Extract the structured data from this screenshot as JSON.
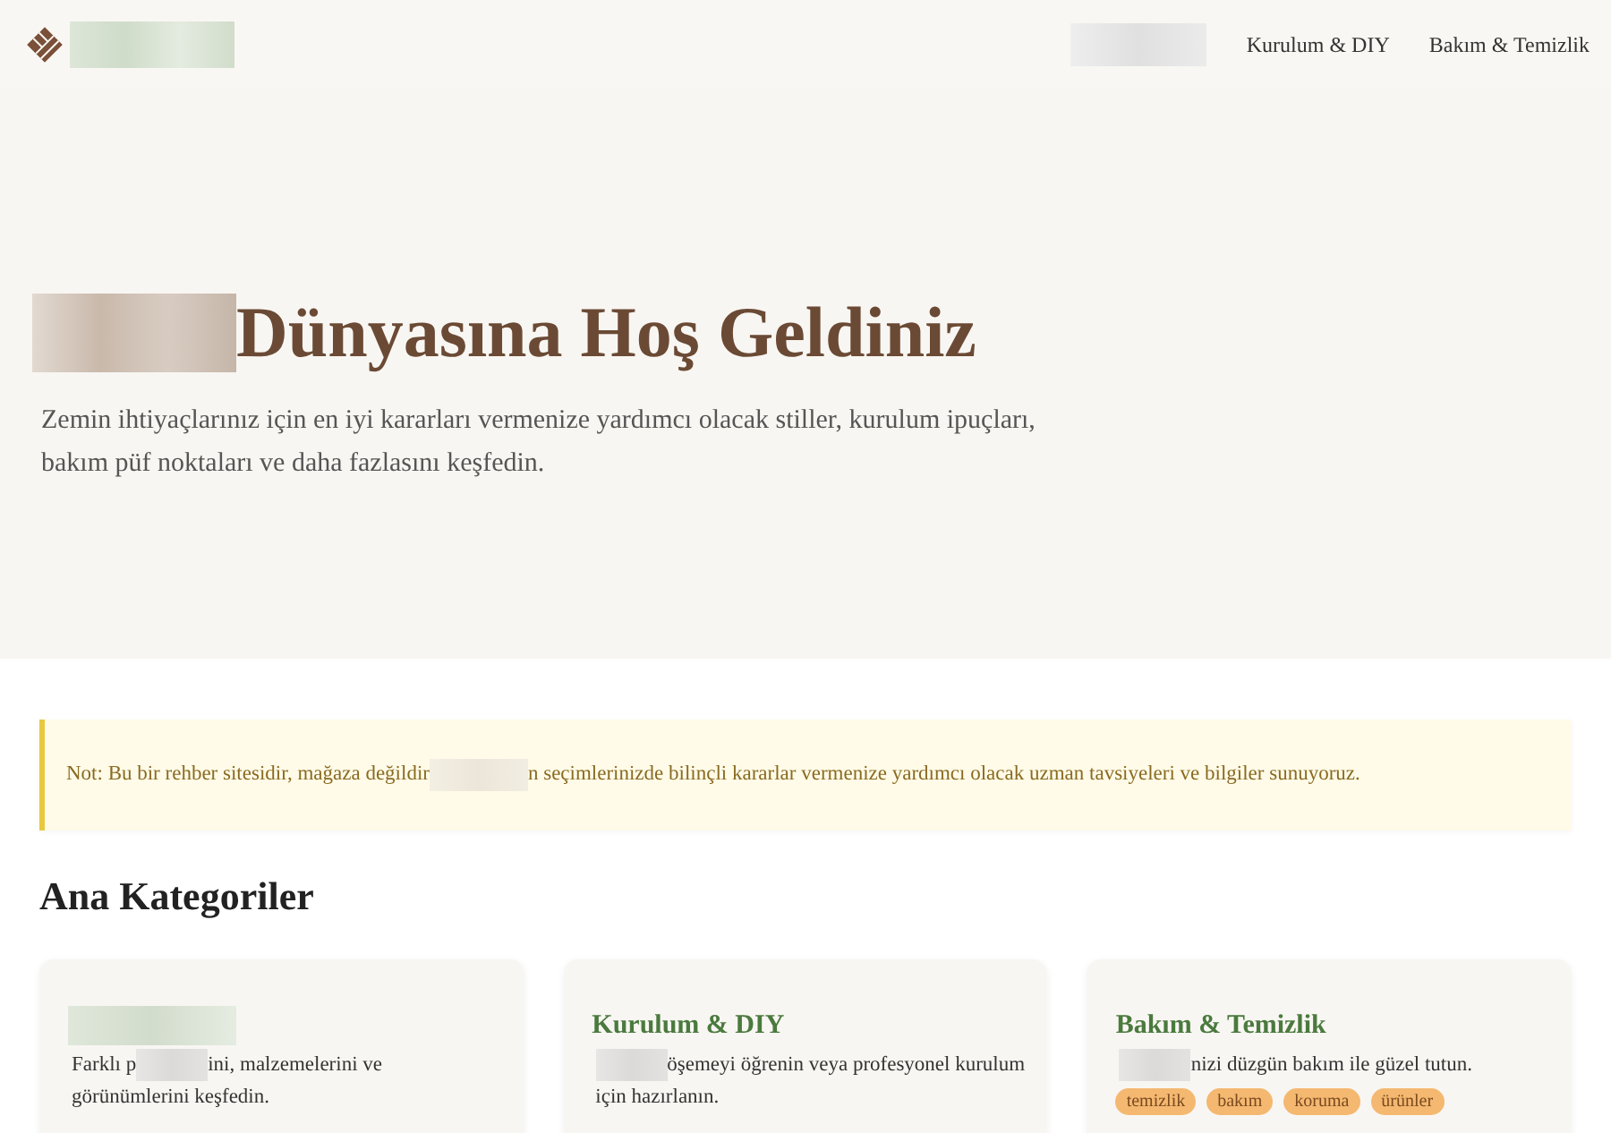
{
  "header": {
    "logo": [
      {
        "kind": "redacted"
      }
    ],
    "nav": [
      {
        "kind": "redacted"
      },
      {
        "kind": "link",
        "text": "Kurulum & DIY"
      },
      {
        "kind": "link",
        "text": "Bakım & Temizlik"
      }
    ]
  },
  "hero": {
    "title": [
      {
        "kind": "redacted"
      },
      {
        "kind": "text",
        "text": "Dünyasına Hoş Geldiniz"
      }
    ],
    "subtitle": "Zemin ihtiyaçlarınız için en iyi kararları vermenize yardımcı olacak stiller, kurulum ipuçları, bakım püf noktaları ve daha fazlasını keşfedin."
  },
  "notice": [
    {
      "kind": "text",
      "text": "Not: Bu bir rehber sitesidir, mağaza değildir"
    },
    {
      "kind": "redacted"
    },
    {
      "kind": "text",
      "text": "n seçimlerinizde bilinçli kararlar vermenize yardımcı olacak uzman tavsiyeleri ve bilgiler sunuyoruz."
    }
  ],
  "section_title": "Ana Kategoriler",
  "cards": [
    {
      "title": [
        {
          "kind": "redacted"
        }
      ],
      "description": [
        {
          "kind": "text",
          "text": "Farklı p"
        },
        {
          "kind": "redacted"
        },
        {
          "kind": "text",
          "text": "ini, malzemelerini ve"
        },
        {
          "kind": "break"
        },
        {
          "kind": "text",
          "text": "görünümlerini keşfedin."
        }
      ]
    },
    {
      "title": [
        {
          "kind": "text",
          "text": "Kurulum & DIY"
        }
      ],
      "description": [
        {
          "kind": "redacted"
        },
        {
          "kind": "text",
          "text": "öşemeyi öğrenin veya profesyonel kurulum"
        },
        {
          "kind": "break"
        },
        {
          "kind": "text",
          "text": "için hazırlanın."
        }
      ]
    },
    {
      "title": [
        {
          "kind": "text",
          "text": "Bakım & Temizlik"
        }
      ],
      "description": [
        {
          "kind": "redacted"
        },
        {
          "kind": "text",
          "text": "nizi düzgün bakım ile güzel tutun."
        }
      ],
      "tags": [
        "temizlik",
        "bakım",
        "koruma",
        "ürünler"
      ]
    }
  ]
}
